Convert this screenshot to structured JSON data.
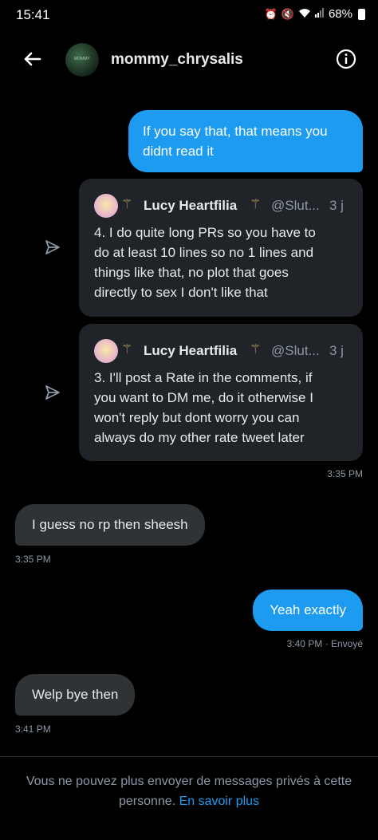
{
  "status_bar": {
    "time": "15:41",
    "battery": "68%"
  },
  "header": {
    "username": "mommy_chrysalis",
    "avatar_text": "MOMMY"
  },
  "messages": [
    {
      "text_lines": [
        "If you say that, that means you",
        "didnt read it"
      ]
    },
    {
      "shared_tweet": {
        "name": "Lucy Heartfilia",
        "handle": "@Slut...",
        "time": "3 j",
        "text_lines": [
          "4. I do quite long PRs so you have to",
          "do at least 10 lines so no 1 lines and",
          "things like that, no plot that goes",
          "directly to sex I don't like that"
        ]
      }
    },
    {
      "shared_tweet": {
        "name": "Lucy Heartfilia",
        "handle": "@Slut...",
        "time": "3 j",
        "text_lines": [
          "3. I'll post a Rate in the comments, if",
          "you want to DM me, do it otherwise I",
          "won't reply but dont worry you can",
          "always do my other rate tweet later"
        ]
      }
    },
    {
      "timestamp": "3:35 PM"
    },
    {
      "text": "I guess no rp then sheesh",
      "timestamp": "3:35 PM"
    },
    {
      "text": "Yeah exactly",
      "timestamp": "3:40 PM · Envoyé"
    },
    {
      "text": "Welp bye then",
      "timestamp": "3:41 PM"
    }
  ],
  "footer": {
    "notice_line1": "Vous ne pouvez plus envoyer de messages privés à cette",
    "notice_line2": "personne.",
    "learn_more": "En savoir plus"
  }
}
